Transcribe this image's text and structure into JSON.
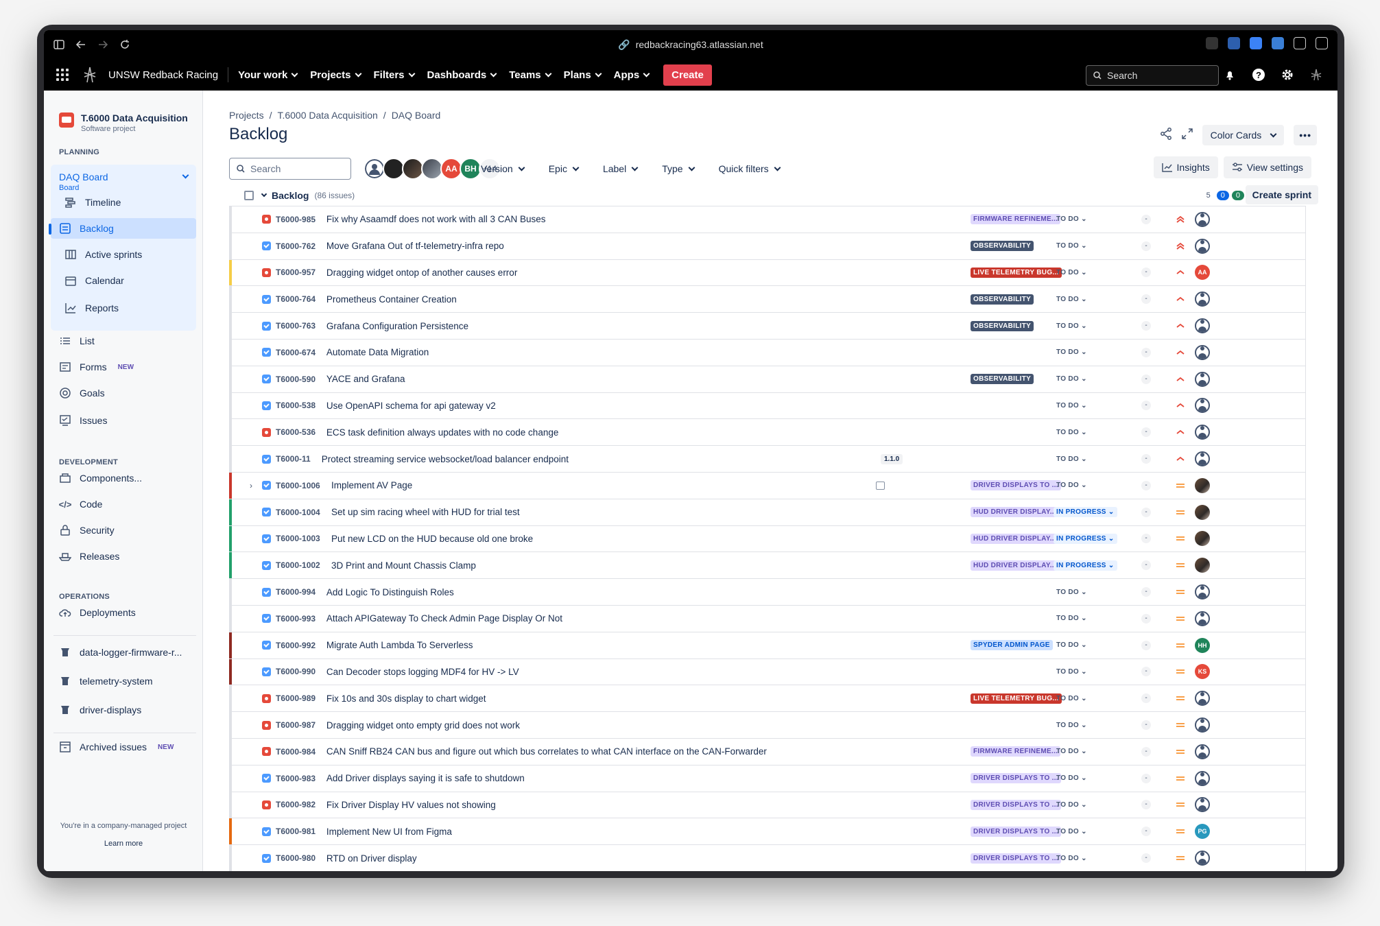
{
  "browser": {
    "url": "redbackracing63.atlassian.net"
  },
  "topnav": {
    "brand": "UNSW Redback Racing",
    "items": [
      "Your work",
      "Projects",
      "Filters",
      "Dashboards",
      "Teams",
      "Plans",
      "Apps"
    ],
    "create": "Create",
    "search_placeholder": "Search"
  },
  "sidebar": {
    "project_name": "T.6000 Data Acquisition",
    "project_type": "Software project",
    "planning_label": "PLANNING",
    "board_name": "DAQ Board",
    "board_type": "Board",
    "planning_items": [
      "Timeline",
      "Backlog",
      "Active sprints",
      "Calendar",
      "Reports"
    ],
    "other_items": [
      "List",
      "Forms",
      "Goals",
      "Issues"
    ],
    "new_badge": "NEW",
    "development_label": "DEVELOPMENT",
    "development_items": [
      "Components...",
      "Code",
      "Security",
      "Releases"
    ],
    "operations_label": "OPERATIONS",
    "operations_items": [
      "Deployments"
    ],
    "repos": [
      "data-logger-firmware-r...",
      "telemetry-system",
      "driver-displays"
    ],
    "archived": "Archived issues",
    "company_note": "You're in a company-managed project",
    "learn_more": "Learn more"
  },
  "main": {
    "breadcrumbs": [
      "Projects",
      "T.6000 Data Acquisition",
      "DAQ Board"
    ],
    "title": "Backlog",
    "color_cards": "Color Cards",
    "search_placeholder": "Search",
    "avatar_initials": [
      "AA",
      "BH"
    ],
    "avatar_more": "+14",
    "filters": [
      "Version",
      "Epic",
      "Label",
      "Type",
      "Quick filters"
    ],
    "insights": "Insights",
    "view_settings": "View settings",
    "backlog_label": "Backlog",
    "issue_count": "(86 issues)",
    "count_todo": "5",
    "count_inprogress": "0",
    "count_done": "0",
    "create_sprint": "Create sprint"
  },
  "colors": {
    "observability": "#44546f",
    "firmware": "#dfd8fd",
    "live_bug": "#c9372c",
    "driver_displays": "#dfd8fd",
    "hud": "#dfd8fd",
    "spyder": "#cce0ff",
    "priority_high": "#e5493a",
    "priority_medium": "#f79232"
  },
  "issues": [
    {
      "type": "bug",
      "key": "T6000-985",
      "summary": "Fix why Asaamdf does not work with all 3 CAN Buses",
      "epic": "FIRMWARE REFINEME...",
      "epic_style": "purple",
      "status": "TO DO",
      "estimate": "-",
      "priority": "highest",
      "assignee": "",
      "bar": "#dfe1e6"
    },
    {
      "type": "story",
      "key": "T6000-762",
      "summary": "Move Grafana Out of tf-telemetry-infra repo",
      "epic": "OBSERVABILITY",
      "epic_style": "dark",
      "status": "TO DO",
      "estimate": "-",
      "priority": "highest",
      "assignee": "",
      "bar": "#dfe1e6"
    },
    {
      "type": "bug",
      "key": "T6000-957",
      "summary": "Dragging widget ontop of another causes error",
      "epic": "LIVE TELEMETRY BUG...",
      "epic_style": "red",
      "status": "TO DO",
      "estimate": "-",
      "priority": "high",
      "assignee": "AA",
      "assignee_color": "#e5493a",
      "bar": "#f5cd47"
    },
    {
      "type": "story",
      "key": "T6000-764",
      "summary": "Prometheus Container Creation",
      "epic": "OBSERVABILITY",
      "epic_style": "dark",
      "status": "TO DO",
      "estimate": "-",
      "priority": "high",
      "assignee": "",
      "bar": "#dfe1e6"
    },
    {
      "type": "story",
      "key": "T6000-763",
      "summary": "Grafana Configuration Persistence",
      "epic": "OBSERVABILITY",
      "epic_style": "dark",
      "status": "TO DO",
      "estimate": "-",
      "priority": "high",
      "assignee": "",
      "bar": "#dfe1e6"
    },
    {
      "type": "story",
      "key": "T6000-674",
      "summary": "Automate Data Migration",
      "epic": "",
      "epic_style": "",
      "status": "TO DO",
      "estimate": "-",
      "priority": "high",
      "assignee": "",
      "bar": "#dfe1e6"
    },
    {
      "type": "story",
      "key": "T6000-590",
      "summary": "YACE and Grafana",
      "epic": "OBSERVABILITY",
      "epic_style": "dark",
      "status": "TO DO",
      "estimate": "-",
      "priority": "high",
      "assignee": "",
      "bar": "#dfe1e6"
    },
    {
      "type": "story",
      "key": "T6000-538",
      "summary": "Use OpenAPI schema for api gateway v2",
      "epic": "",
      "epic_style": "",
      "status": "TO DO",
      "estimate": "-",
      "priority": "high",
      "assignee": "",
      "bar": "#dfe1e6"
    },
    {
      "type": "bug",
      "key": "T6000-536",
      "summary": "ECS task definition always updates with no code change",
      "epic": "",
      "epic_style": "",
      "status": "TO DO",
      "estimate": "-",
      "priority": "high",
      "assignee": "",
      "bar": "#dfe1e6"
    },
    {
      "type": "story",
      "key": "T6000-11",
      "summary": "Protect streaming service websocket/load balancer endpoint",
      "version": "1.1.0",
      "epic": "",
      "epic_style": "",
      "status": "TO DO",
      "estimate": "-",
      "priority": "high",
      "assignee": "",
      "bar": "#dfe1e6"
    },
    {
      "type": "story",
      "key": "T6000-1006",
      "summary": "Implement AV Page",
      "epic": "DRIVER DISPLAYS TO ...",
      "epic_style": "purple",
      "status": "TO DO",
      "estimate": "-",
      "priority": "medium",
      "assignee": "photo",
      "bar": "#c9372c",
      "expand": true,
      "subtasks": true
    },
    {
      "type": "story",
      "key": "T6000-1004",
      "summary": "Set up sim racing wheel with HUD for trial test",
      "epic": "HUD DRIVER DISPLAY...",
      "epic_style": "purple",
      "status": "IN PROGRESS",
      "estimate": "-",
      "priority": "medium",
      "assignee": "photo",
      "bar": "#22a06b"
    },
    {
      "type": "story",
      "key": "T6000-1003",
      "summary": "Put new LCD on the HUD because old one broke",
      "epic": "HUD DRIVER DISPLAY...",
      "epic_style": "purple",
      "status": "IN PROGRESS",
      "estimate": "-",
      "priority": "medium",
      "assignee": "photo",
      "bar": "#22a06b"
    },
    {
      "type": "story",
      "key": "T6000-1002",
      "summary": "3D Print and Mount Chassis Clamp",
      "epic": "HUD DRIVER DISPLAY...",
      "epic_style": "purple",
      "status": "IN PROGRESS",
      "estimate": "-",
      "priority": "medium",
      "assignee": "photo",
      "bar": "#22a06b"
    },
    {
      "type": "story",
      "key": "T6000-994",
      "summary": "Add Logic To Distinguish Roles",
      "epic": "",
      "epic_style": "",
      "status": "TO DO",
      "estimate": "-",
      "priority": "medium",
      "assignee": "",
      "bar": "#dfe1e6"
    },
    {
      "type": "story",
      "key": "T6000-993",
      "summary": "Attach APIGateway To Check Admin Page Display Or Not",
      "epic": "",
      "epic_style": "",
      "status": "TO DO",
      "estimate": "-",
      "priority": "medium",
      "assignee": "",
      "bar": "#dfe1e6"
    },
    {
      "type": "story",
      "key": "T6000-992",
      "summary": "Migrate Auth Lambda To Serverless",
      "epic": "SPYDER ADMIN PAGE",
      "epic_style": "blue",
      "status": "TO DO",
      "estimate": "-",
      "priority": "medium",
      "assignee": "HH",
      "assignee_color": "#1f845a",
      "bar": "#8f2a22"
    },
    {
      "type": "story",
      "key": "T6000-990",
      "summary": "Can Decoder stops logging MDF4 for HV -> LV",
      "epic": "",
      "epic_style": "",
      "status": "TO DO",
      "estimate": "-",
      "priority": "medium",
      "assignee": "KS",
      "assignee_color": "#e5493a",
      "bar": "#8f2a22"
    },
    {
      "type": "bug",
      "key": "T6000-989",
      "summary": "Fix 10s and 30s display to chart widget",
      "epic": "LIVE TELEMETRY BUG...",
      "epic_style": "red",
      "status": "TO DO",
      "estimate": "-",
      "priority": "medium",
      "assignee": "",
      "bar": "#dfe1e6"
    },
    {
      "type": "bug",
      "key": "T6000-987",
      "summary": "Dragging widget onto empty grid does not work",
      "epic": "",
      "epic_style": "",
      "status": "TO DO",
      "estimate": "-",
      "priority": "medium",
      "assignee": "",
      "bar": "#dfe1e6"
    },
    {
      "type": "bug",
      "key": "T6000-984",
      "summary": "CAN Sniff RB24 CAN bus and figure out which bus correlates to what CAN interface on the CAN-Forwarder",
      "epic": "FIRMWARE REFINEME...",
      "epic_style": "purple",
      "status": "TO DO",
      "estimate": "-",
      "priority": "medium",
      "assignee": "",
      "bar": "#dfe1e6"
    },
    {
      "type": "story",
      "key": "T6000-983",
      "summary": "Add Driver displays saying it is safe to shutdown",
      "epic": "DRIVER DISPLAYS TO ...",
      "epic_style": "purple",
      "status": "TO DO",
      "estimate": "-",
      "priority": "medium",
      "assignee": "",
      "bar": "#dfe1e6"
    },
    {
      "type": "bug",
      "key": "T6000-982",
      "summary": "Fix Driver Display HV values not showing",
      "epic": "DRIVER DISPLAYS TO ...",
      "epic_style": "purple",
      "status": "TO DO",
      "estimate": "-",
      "priority": "medium",
      "assignee": "",
      "bar": "#dfe1e6"
    },
    {
      "type": "story",
      "key": "T6000-981",
      "summary": "Implement New UI from Figma",
      "epic": "DRIVER DISPLAYS TO ...",
      "epic_style": "purple",
      "status": "TO DO",
      "estimate": "-",
      "priority": "medium",
      "assignee": "PG",
      "assignee_color": "#2898bd",
      "bar": "#e56910"
    },
    {
      "type": "story",
      "key": "T6000-980",
      "summary": "RTD on Driver display",
      "epic": "DRIVER DISPLAYS TO ...",
      "epic_style": "purple",
      "status": "TO DO",
      "estimate": "-",
      "priority": "medium",
      "assignee": "",
      "bar": "#dfe1e6"
    }
  ]
}
